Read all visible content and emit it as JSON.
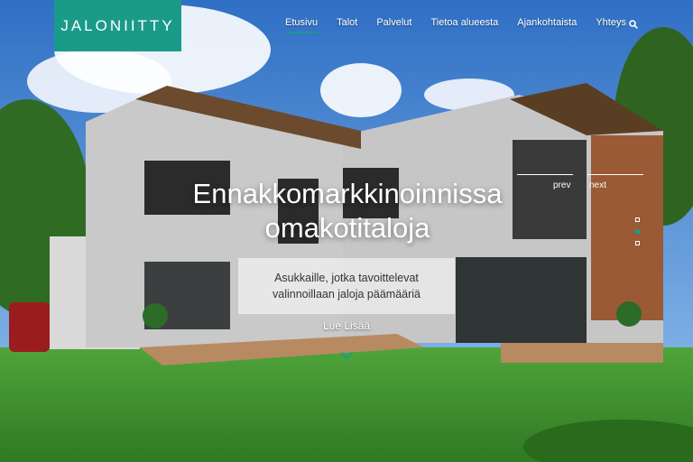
{
  "brand": {
    "logo_text": "JALONIITTY"
  },
  "nav": {
    "items": [
      {
        "label": "Etusivu",
        "active": true
      },
      {
        "label": "Talot"
      },
      {
        "label": "Palvelut"
      },
      {
        "label": "Tietoa alueesta"
      },
      {
        "label": "Ajankohtaista"
      },
      {
        "label": "Yhteys"
      }
    ],
    "search_icon": "search-icon"
  },
  "hero": {
    "headline_line1": "Ennakkomarkkinoinnissa",
    "headline_line2": "omakotitaloja",
    "subtext_line1": "Asukkaille, jotka tavoittelevat",
    "subtext_line2": "valinnoillaan jaloja päämääriä",
    "cta_label": "Lue Lisää",
    "prev_label": "prev",
    "next_label": "next",
    "slide_count": 3,
    "active_slide": 2
  },
  "colors": {
    "accent": "#1a9b8a",
    "sky": "#3f7fd0",
    "grass": "#3f9a2f"
  }
}
